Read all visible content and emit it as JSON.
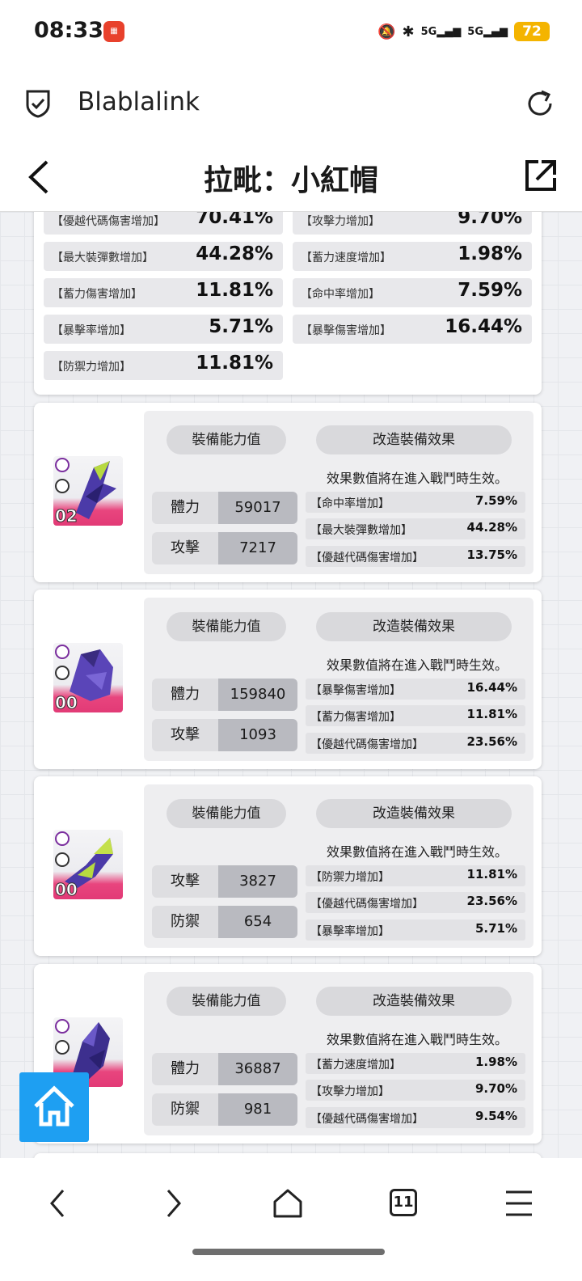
{
  "status": {
    "time": "08:33",
    "signal_a": "5G",
    "signal_b": "5G",
    "battery": "72"
  },
  "browser": {
    "site_name": "Blablalink"
  },
  "header": {
    "title": "拉毗：小紅帽"
  },
  "summary": {
    "stats": [
      {
        "label": "【優越代碼傷害增加】",
        "value": "70.41%"
      },
      {
        "label": "【攻擊力增加】",
        "value": "9.70%"
      },
      {
        "label": "【最大裝彈數增加】",
        "value": "44.28%"
      },
      {
        "label": "【蓄力速度增加】",
        "value": "1.98%"
      },
      {
        "label": "【蓄力傷害增加】",
        "value": "11.81%"
      },
      {
        "label": "【命中率增加】",
        "value": "7.59%"
      },
      {
        "label": "【暴擊率增加】",
        "value": "5.71%"
      },
      {
        "label": "【暴擊傷害增加】",
        "value": "16.44%"
      },
      {
        "label": "【防禦力增加】",
        "value": "11.81%"
      }
    ]
  },
  "common": {
    "ability_label": "裝備能力值",
    "effect_label": "改造裝備效果",
    "note": "效果數值將在進入戰鬥時生效。"
  },
  "gear": [
    {
      "level": "02",
      "stats": [
        {
          "k": "體力",
          "v": "59017"
        },
        {
          "k": "攻擊",
          "v": "7217"
        }
      ],
      "effects": [
        {
          "l": "【命中率增加】",
          "v": "7.59%"
        },
        {
          "l": "【最大裝彈數增加】",
          "v": "44.28%"
        },
        {
          "l": "【優越代碼傷害增加】",
          "v": "13.75%"
        }
      ]
    },
    {
      "level": "00",
      "stats": [
        {
          "k": "體力",
          "v": "159840"
        },
        {
          "k": "攻擊",
          "v": "1093"
        }
      ],
      "effects": [
        {
          "l": "【暴擊傷害增加】",
          "v": "16.44%"
        },
        {
          "l": "【蓄力傷害增加】",
          "v": "11.81%"
        },
        {
          "l": "【優越代碼傷害增加】",
          "v": "23.56%"
        }
      ]
    },
    {
      "level": "00",
      "stats": [
        {
          "k": "攻擊",
          "v": "3827"
        },
        {
          "k": "防禦",
          "v": "654"
        }
      ],
      "effects": [
        {
          "l": "【防禦力增加】",
          "v": "11.81%"
        },
        {
          "l": "【優越代碼傷害增加】",
          "v": "23.56%"
        },
        {
          "l": "【暴擊率增加】",
          "v": "5.71%"
        }
      ]
    },
    {
      "level": "",
      "stats": [
        {
          "k": "體力",
          "v": "36887"
        },
        {
          "k": "防禦",
          "v": "981"
        }
      ],
      "effects": [
        {
          "l": "【蓄力速度增加】",
          "v": "1.98%"
        },
        {
          "l": "【攻擊力增加】",
          "v": "9.70%"
        },
        {
          "l": "【優越代碼傷害增加】",
          "v": "9.54%"
        }
      ]
    }
  ],
  "nav": {
    "tab_count": "11"
  },
  "colors": {
    "accent": "#1e9ff2",
    "gear_gradient": "#e23a76",
    "battery": "#f4b400"
  }
}
